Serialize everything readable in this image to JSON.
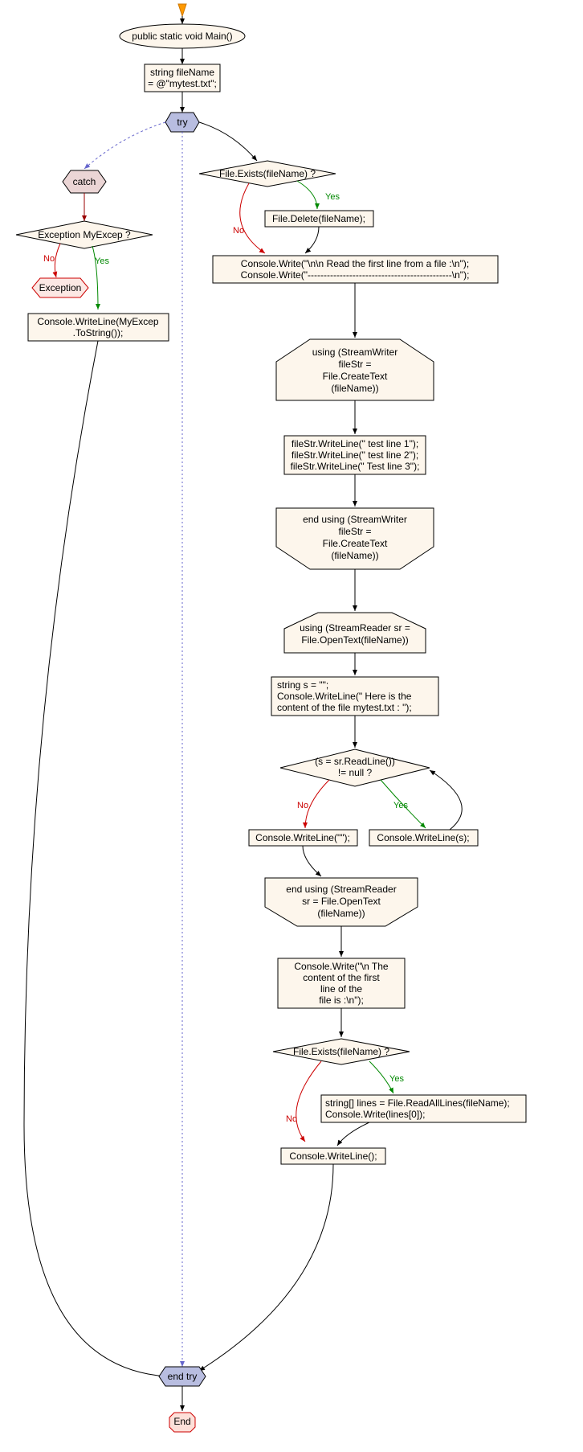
{
  "nodes": {
    "start_arrow": "",
    "main": "public static void Main()",
    "filename": "string fileName\n= @\"mytest.txt\";",
    "try": "try",
    "catch": "catch",
    "exc_check": "Exception MyExcep ?",
    "exc": "Exception",
    "exc_write": "Console.WriteLine(MyExcep\n.ToString());",
    "file_exists1": "File.Exists(fileName) ?",
    "file_delete": "File.Delete(fileName);",
    "console1": "Console.Write(\"\\n\\n Read the first line from a file  :\\n\");\nConsole.Write(\"---------------------------------------------\\n\");",
    "using1": "using (StreamWriter\nfileStr =\nFile.CreateText\n(fileName))",
    "writelines": "fileStr.WriteLine(\" test line 1\");\nfileStr.WriteLine(\" test line 2\");\nfileStr.WriteLine(\" Test line 3\");",
    "endusing1": "end using (StreamWriter\nfileStr =\nFile.CreateText\n(fileName))",
    "using2": "using (StreamReader sr =\nFile.OpenText(fileName))",
    "strbody": "string s = \"\";\nConsole.WriteLine(\" Here is the\ncontent of the file mytest.txt : \");",
    "readline": "(s = sr.ReadLine())\n!= null ?",
    "writeln_empty": "Console.WriteLine(\"\");",
    "writeln_s": "Console.WriteLine(s);",
    "endusing2": "end using (StreamReader\nsr = File.OpenText\n(fileName))",
    "console2": "Console.Write(\"\\n The\ncontent of the first\nline of the\nfile is :\\n\");",
    "file_exists2": "File.Exists(fileName) ?",
    "readall": "string[] lines = File.ReadAllLines(fileName);\nConsole.Write(lines[0]);",
    "writeln_final": "Console.WriteLine();",
    "endtry": "end try",
    "end": "End"
  },
  "labels": {
    "yes": "Yes",
    "no": "No"
  },
  "colors": {
    "node_fill": "#fdf6ec",
    "node_stroke": "#000000",
    "try_fill": "#b8bde0",
    "catch_fill": "#ebd5d5",
    "exception_fill": "#fce8e4",
    "exception_text": "#d22",
    "end_fill": "#fde0d9",
    "yes": "#008800",
    "no": "#cc0000",
    "dashed": "#6666cc",
    "arrow": "#000000"
  }
}
